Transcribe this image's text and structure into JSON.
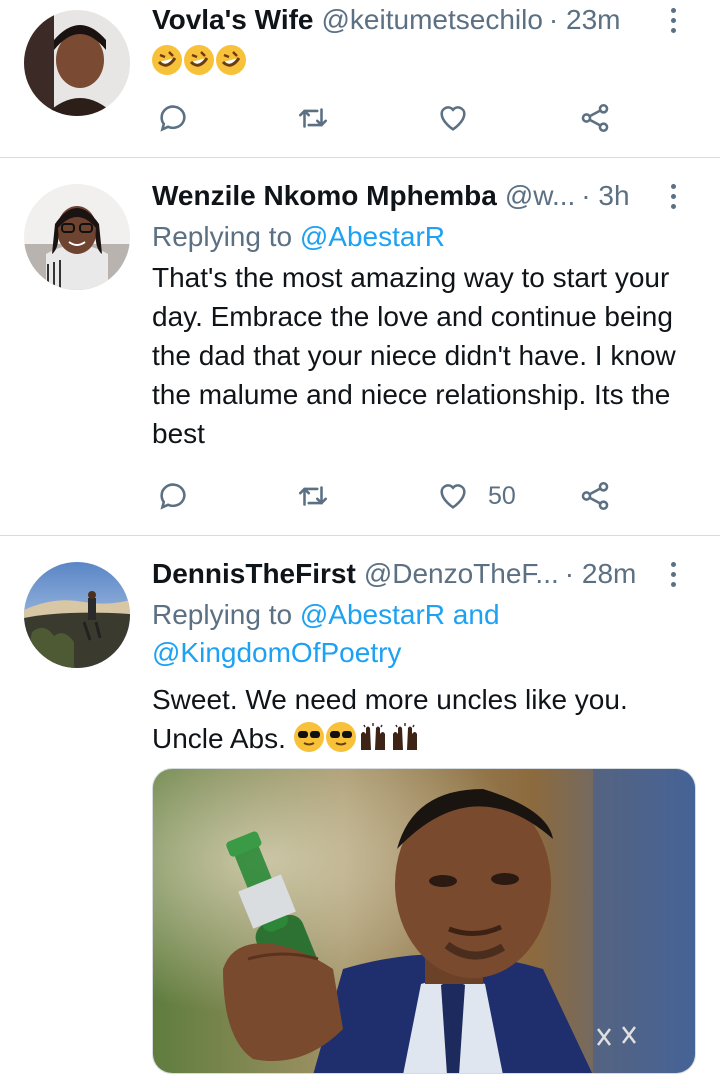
{
  "tweets": [
    {
      "name": "Vovla's Wife",
      "handle": "@keitumetsechilo",
      "time": "· 23m",
      "text_emojis": [
        "rofl-emoji",
        "rofl-emoji",
        "rofl-emoji"
      ],
      "actions": {
        "reply": "",
        "retweet": "",
        "like": "",
        "share": ""
      }
    },
    {
      "name": "Wenzile Nkomo Mphemba",
      "handle": "@w...",
      "time": "· 3h",
      "replying_prefix": "Replying to",
      "replying_to": "@AbestarR",
      "text": "That's the most amazing way to start your day. Embrace the love and continue being the dad that your niece didn't have. I know the malume and niece relationship. Its the best",
      "actions": {
        "like_count": "50"
      }
    },
    {
      "name": "DennisTheFirst",
      "handle": "@DenzoTheF...",
      "time": "· 28m",
      "replying_prefix": "Replying to",
      "replying_to": "@AbestarR",
      "replying_and": "and",
      "replying_to_2": "@KingdomOfPoetry",
      "text": "Sweet. We need more uncles like you. Uncle Abs.",
      "text_emojis": [
        "sunglasses-emoji",
        "sunglasses-emoji",
        "raised-hands-emoji",
        "raised-hands-emoji"
      ]
    }
  ],
  "colors": {
    "accent": "#1da1f2",
    "secondary_text": "#5b7083",
    "divider": "#d6dbe0"
  }
}
